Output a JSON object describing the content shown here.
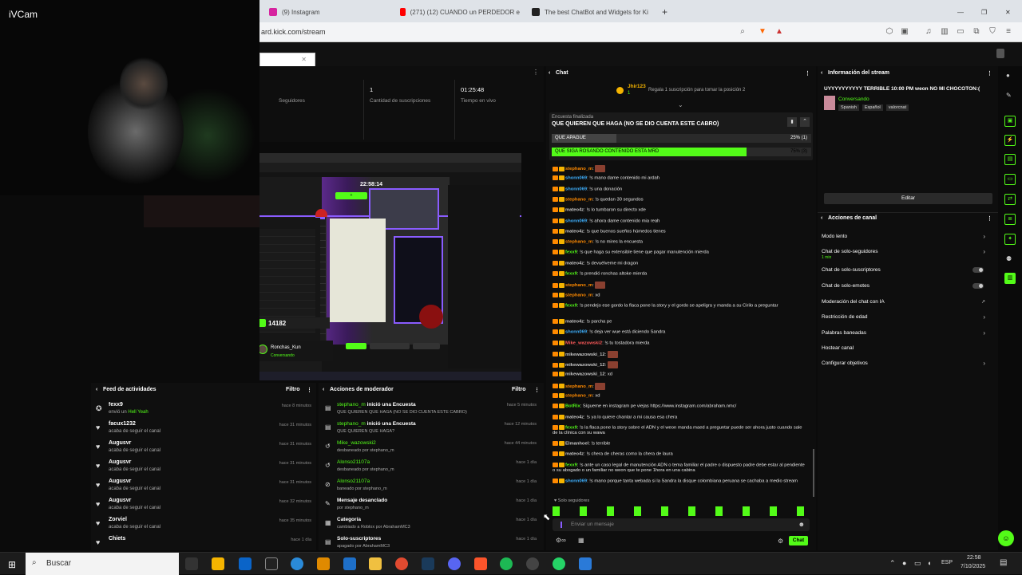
{
  "ivcam": {
    "title": "iVCam"
  },
  "browser": {
    "tabs": [
      {
        "label": "(9) Instagram",
        "color": "#d6249f"
      },
      {
        "label": "(271) (12) CUANDO un PERDEDOR e",
        "color": "#ff0000"
      },
      {
        "label": "The best ChatBot and Widgets for Ki",
        "color": "#222222"
      }
    ],
    "url": "ard.kick.com/stream"
  },
  "stats": [
    {
      "value": "",
      "label": "Seguidores"
    },
    {
      "value": "1",
      "label": "Cantidad de suscripciones"
    },
    {
      "value": "01:25:48",
      "label": "Tiempo en vivo"
    }
  ],
  "preview": {
    "timer": "22:58:14",
    "counter": "14182",
    "streamer": "Ronchas_Kun",
    "tag": "Conversando"
  },
  "feed": {
    "title": "Feed de actividades",
    "filter": "Filtro",
    "items": [
      {
        "name": "fexx9",
        "sub": "envió un",
        "extra": "Hell Yeah",
        "time": "hace 8 minutos",
        "icon": "gift-icon"
      },
      {
        "name": "facux1232",
        "sub": "acaba de seguir el canal",
        "time": "hace 31 minutos",
        "icon": "heart-icon"
      },
      {
        "name": "Augusvr",
        "sub": "acaba de seguir el canal",
        "time": "hace 31 minutos",
        "icon": "heart-icon"
      },
      {
        "name": "Augusvr",
        "sub": "acaba de seguir el canal",
        "time": "hace 31 minutos",
        "icon": "heart-icon"
      },
      {
        "name": "Augusvr",
        "sub": "acaba de seguir el canal",
        "time": "hace 31 minutos",
        "icon": "heart-icon"
      },
      {
        "name": "Augusvr",
        "sub": "acaba de seguir el canal",
        "time": "hace 32 minutos",
        "icon": "heart-icon"
      },
      {
        "name": "Zorviel",
        "sub": "acaba de seguir el canal",
        "time": "hace 35 minutos",
        "icon": "heart-icon"
      },
      {
        "name": "Chiets",
        "sub": "",
        "time": "hace 1 día",
        "icon": "heart-icon"
      }
    ]
  },
  "mod": {
    "title": "Acciones de moderador",
    "filter": "Filtro",
    "items": [
      {
        "user": "stephano_m",
        "action": "inició una Encuesta",
        "sub": "QUE QUIEREN QUE HAGA (NO SE DIO CUENTA ESTE CABRO)",
        "time": "hace 5 minutos",
        "icon": "poll-icon"
      },
      {
        "user": "stephano_m",
        "action": "inició una Encuesta",
        "sub": "QUE QUIEREN QUE HAGA?",
        "time": "hace 12 minutos",
        "icon": "poll-icon"
      },
      {
        "user": "Mike_wazowski2",
        "action": "",
        "sub": "desbaneado por stephano_m",
        "time": "hace 44 minutos",
        "icon": "unban-icon"
      },
      {
        "user": "Alonso21107a",
        "action": "",
        "sub": "desbaneado por stephano_m",
        "time": "hace 1 día",
        "icon": "unban-icon"
      },
      {
        "user": "Alonso21107a",
        "action": "",
        "sub": "baneado por stephano_m",
        "time": "hace 1 día",
        "icon": "ban-icon"
      },
      {
        "user": "",
        "action": "Mensaje desanclado",
        "sub": "por stephano_m",
        "time": "hace 1 día",
        "icon": "pin-icon"
      },
      {
        "user": "",
        "action": "Categoría",
        "sub": "cambiado a Roblox por AbrahamMC3",
        "time": "hace 1 día",
        "icon": "category-icon"
      },
      {
        "user": "",
        "action": "Solo-suscriptores",
        "sub": "apagado por AbrahamMC3",
        "time": "hace 1 día",
        "icon": "subs-icon"
      }
    ]
  },
  "chat": {
    "title": "Chat",
    "top_user": "Jhir123",
    "top_count": "1",
    "gift_prompt": "Regala 1 suscripción para tomar la posición 2",
    "poll": {
      "status": "Encuesta finalizada",
      "question": "QUE QUIEREN QUE HAGA (NO SE DIO CUENTA ESTE CABRO)",
      "options": [
        {
          "label": "QUE APAGUE",
          "result": "25% (1)",
          "fraction": 0.25
        },
        {
          "label": "QUE SIGA ROSANDO CONTENIDO ESTA MRD",
          "result": "75% (3)",
          "fraction": 0.75
        }
      ]
    },
    "messages": [
      {
        "user": "stephano_m",
        "color": "#ff8a00",
        "text": "",
        "emote": true
      },
      {
        "user": "shonn069",
        "color": "#3fb1ff",
        "text": "!s mano dame contenido mi ardah"
      },
      {
        "user": "shonn069",
        "color": "#3fb1ff",
        "text": "!s una donación"
      },
      {
        "user": "stephano_m",
        "color": "#ff8a00",
        "text": "!s quedan 30 segundos"
      },
      {
        "user": "mateo4z",
        "color": "#c7c7c7",
        "text": "!s lo tumbaron su directo xde"
      },
      {
        "user": "shonn069",
        "color": "#3fb1ff",
        "text": "!s ahora dame contenido mia reah"
      },
      {
        "user": "mateo4z",
        "color": "#c7c7c7",
        "text": "!s que buenos sueños húmedos tienes"
      },
      {
        "user": "stephano_m",
        "color": "#ff8a00",
        "text": "!s no mires la encuesta"
      },
      {
        "user": "fexx9",
        "color": "#53fc18",
        "text": "!s que haga su extensible tiene que pagar manutención mierda"
      },
      {
        "user": "mateo4z",
        "color": "#c7c7c7",
        "text": "!s devuélveme mi dragon"
      },
      {
        "user": "fexx9",
        "color": "#53fc18",
        "text": "!s prendió ronchas altoke mierda"
      },
      {
        "user": "stephano_m",
        "color": "#ff8a00",
        "text": "",
        "emote": true
      },
      {
        "user": "stephano_m",
        "color": "#ff8a00",
        "text": "xd"
      },
      {
        "user": "fexx9",
        "color": "#53fc18",
        "text": "!s pendejo ese gordo la flaca pone la story y el gordo se apeligra y manda a su Cirilo a preguntar"
      },
      {
        "user": "mateo4z",
        "color": "#c7c7c7",
        "text": "!s parcha pe"
      },
      {
        "user": "shonn069",
        "color": "#3fb1ff",
        "text": "!s deja ver wue está diciendo Sandra"
      },
      {
        "user": "Mike_wazowski2",
        "color": "#ff5a5a",
        "text": "!s tu tostadora mierda"
      },
      {
        "user": "mikewazowski_12",
        "color": "#c7c7c7",
        "text": "",
        "emote": true
      },
      {
        "user": "mikewazowski_12",
        "color": "#c7c7c7",
        "text": "",
        "emote": true
      },
      {
        "user": "mikewazowski_12",
        "color": "#c7c7c7",
        "text": "xd"
      },
      {
        "user": "stephano_m",
        "color": "#ff8a00",
        "text": "",
        "emote": true
      },
      {
        "user": "stephano_m",
        "color": "#ff8a00",
        "text": "xd"
      },
      {
        "user": "BotRix",
        "color": "#53fc18",
        "text": "Sígueme en instagram pe viejas https://www.instagram.com/abraham.nmc/"
      },
      {
        "user": "mateo4z",
        "color": "#c7c7c7",
        "text": "!s ya lo quiere chantar a mi causa esa chera"
      },
      {
        "user": "fexx9",
        "color": "#53fc18",
        "text": "!s la flaca pone la story sobre el ADN y el weon manda maed a preguntar puede ser ahora justo cuando sale de la clínica con su wawa"
      },
      {
        "user": "Elmanhoel",
        "color": "#c7c7c7",
        "text": "!s terrible"
      },
      {
        "user": "mateo4z",
        "color": "#c7c7c7",
        "text": "!s chera de cheras como la chera de laura"
      },
      {
        "user": "fexx9",
        "color": "#53fc18",
        "text": "!s ante un caso legal de manutención ADN o tema familiar el padre o dispuesto padre debe estar al pendiente o su abogado o un familiar no weon que te pone 1hora en una cabina"
      },
      {
        "user": "shonn069",
        "color": "#3fb1ff",
        "text": "!s mano porque tanta webada si la Sandra la disque colombiana peruana se cachaba a medio stream"
      }
    ],
    "followers_only": "Solo seguidores",
    "input_placeholder": "Enviar un mensaje",
    "send_label": "Chat"
  },
  "stream_info": {
    "title": "Información del stream",
    "stream_title": "UYYYYYYYYYY TERRIBLE 10:00 PM weon NO MI CHOCOTON:(",
    "category": "Conversando",
    "tags": [
      "Spanish",
      "Español",
      "valorcnat"
    ],
    "edit_label": "Editar"
  },
  "channel_actions": {
    "title": "Acciones de canal",
    "items": [
      {
        "label": "Modo lento",
        "kind": "chevron"
      },
      {
        "label": "Chat de solo-seguidores",
        "sub": "1 min",
        "kind": "chevron"
      },
      {
        "label": "Chat de solo-suscriptores",
        "kind": "toggle"
      },
      {
        "label": "Chat de solo-emotes",
        "kind": "toggle"
      },
      {
        "label": "Moderación del chat con IA",
        "kind": "external"
      },
      {
        "label": "Restricción de edad",
        "kind": "chevron"
      },
      {
        "label": "Palabras baneadas",
        "kind": "chevron"
      },
      {
        "label": "Hostear canal",
        "kind": "none"
      },
      {
        "label": "Configurar objetivos",
        "kind": "chevron"
      }
    ]
  },
  "taskbar": {
    "search": "Buscar",
    "lang": "ESP",
    "time": "22:58",
    "date": "7/10/2025"
  }
}
